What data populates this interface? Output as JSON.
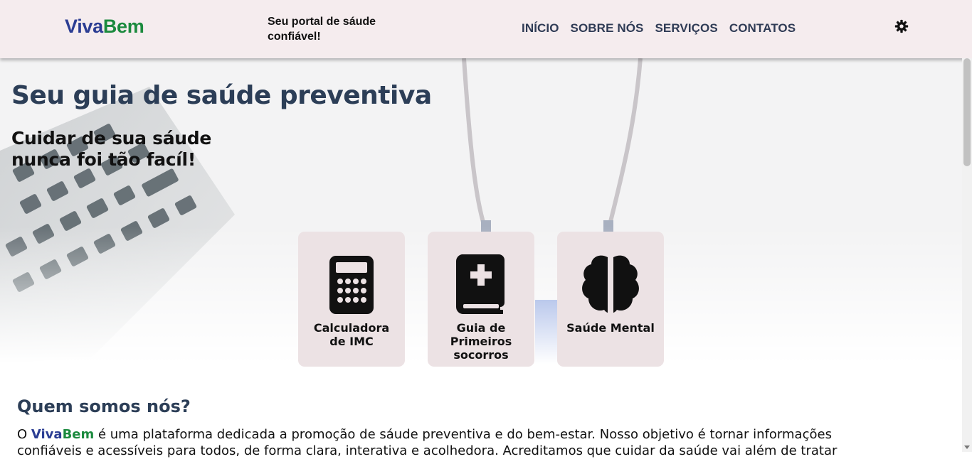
{
  "header": {
    "logo_part1": "Viva",
    "logo_part2": "Bem",
    "tagline": "Seu portal de sáude confiável!",
    "nav": [
      "INÍCIO",
      "SOBRE NÓS",
      "SERVIÇOS",
      "CONTATOS"
    ],
    "settings_icon": "gear-icon"
  },
  "hero": {
    "title": "Seu guia de saúde preventiva",
    "subtitle": "Cuidar de sua sáude nunca foi tão facíl!"
  },
  "cards": [
    {
      "label": "Calculadora de IMC",
      "icon": "calculator-icon"
    },
    {
      "label": "Guia de Primeiros socorros",
      "icon": "medical-book-icon"
    },
    {
      "label": "Saúde Mental",
      "icon": "brain-icon"
    }
  ],
  "about": {
    "title": "Quem somos nós?",
    "text_before": "O ",
    "brand_part1": "Viva",
    "brand_part2": "Bem",
    "text_after": " é uma plataforma dedicada a promoção de sáude preventiva e do bem-estar. Nosso objetivo é tornar informações confiáveis e acessíveis para todos, de forma clara, interativa e acolhedora. Acreditamos que cuidar da saúde vai além de tratar"
  },
  "colors": {
    "brand_blue": "#2b3d93",
    "brand_green": "#1b8a3e",
    "header_bg": "#f5ecee",
    "card_bg": "#ece2e4",
    "title_color": "#2c3e57"
  }
}
